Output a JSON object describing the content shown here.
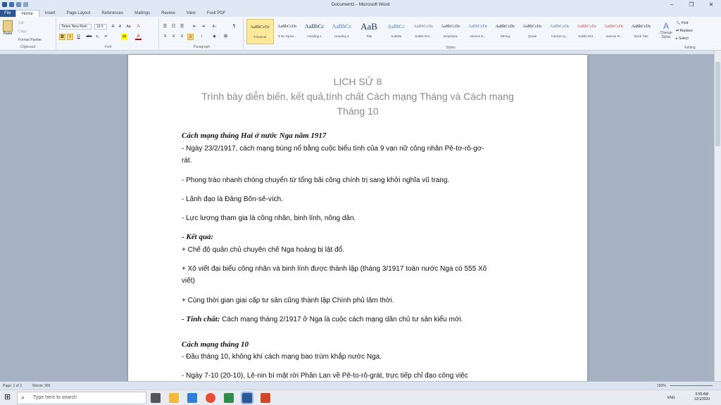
{
  "window": {
    "title": "Document1 - Microsoft Word",
    "minimize": "–",
    "restore": "❐",
    "close": "✕"
  },
  "tabs": [
    "File",
    "Home",
    "Insert",
    "Page Layout",
    "References",
    "Mailings",
    "Review",
    "View",
    "Foxit PDF"
  ],
  "clipboard": {
    "paste": "Paste",
    "cut": "Cut",
    "copy": "Copy",
    "format_painter": "Format Painter",
    "label": "Clipboard"
  },
  "font": {
    "name": "Times New Rom",
    "size": "10.5",
    "label": "Font",
    "bold": "B",
    "italic": "I",
    "underline": "U",
    "strike": "abc",
    "sub": "x₂",
    "sup": "x²",
    "grow": "A",
    "shrink": "A",
    "case": "Aa",
    "clear": "A",
    "highlight": "ab",
    "color": "A"
  },
  "paragraph": {
    "label": "Paragraph",
    "pilcrow": "¶",
    "sort": "A↓"
  },
  "styles": {
    "label": "Styles",
    "items": [
      {
        "preview": "AaBbCcDc",
        "name": "¶ Normal",
        "size": "6",
        "color": "#333"
      },
      {
        "preview": "AaBbCcDc",
        "name": "¶ No Spaci...",
        "size": "6",
        "color": "#333"
      },
      {
        "preview": "AaBbCc",
        "name": "Heading 1",
        "size": "8",
        "color": "#17365d"
      },
      {
        "preview": "AaBbCc",
        "name": "Heading 2",
        "size": "8",
        "color": "#4f81bd"
      },
      {
        "preview": "AaB",
        "name": "Title",
        "size": "13",
        "color": "#17365d"
      },
      {
        "preview": "AaBbCc",
        "name": "Subtitle",
        "size": "7",
        "color": "#4f81bd"
      },
      {
        "preview": "AaBbCcDc",
        "name": "Subtle Em...",
        "size": "6",
        "color": "#777"
      },
      {
        "preview": "AaBbCcDc",
        "name": "Emphasis",
        "size": "6",
        "color": "#333"
      },
      {
        "preview": "AaBbCcDc",
        "name": "Intense E...",
        "size": "6",
        "color": "#4f81bd"
      },
      {
        "preview": "AaBbCcDc",
        "name": "Strong",
        "size": "6",
        "color": "#222"
      },
      {
        "preview": "AaBbCcDc",
        "name": "Quote",
        "size": "6",
        "color": "#333"
      },
      {
        "preview": "AaBbCcDc",
        "name": "Intense Q...",
        "size": "6",
        "color": "#4f81bd"
      },
      {
        "preview": "AaBbCcDc",
        "name": "Subtle Ref...",
        "size": "6",
        "color": "#c0504d"
      },
      {
        "preview": "AaBbCcDc",
        "name": "Intense R...",
        "size": "6",
        "color": "#c0504d"
      },
      {
        "preview": "AaBbCcDc",
        "name": "Book Title",
        "size": "6",
        "color": "#222"
      }
    ],
    "change": "Change Styles"
  },
  "editing": {
    "find": "Find",
    "replace": "Replace",
    "select": "Select",
    "label": "Editing"
  },
  "doc": {
    "title1": "LỊCH SỬ 8",
    "title2": "Trình bày diễn biến, kết quả,tính chất Cách mạng Tháng và Cách mạng",
    "title3": "Tháng 10",
    "h1": "Cách mạng tháng Hai ở nước Nga năm 1917",
    "p1a": "- Ngày 23/2/1917, cách mạng bùng nổ bằng cuộc biểu tình của 9 vạn nữ công nhân Pê-tơ-rô-gơ-",
    "p1b": "rát.",
    "p2": "- Phong trào nhanh chóng chuyển từ tổng bãi công chính trị sang khởi nghĩa vũ trang.",
    "p3": "- Lãnh đạo là Đảng Bôn-sê-vích.",
    "p4": "- Lực lượng tham gia là công nhân, binh lính, nông dân.",
    "kq": "- Kết quả:",
    "p5": "+ Chế độ quân chủ chuyên chế Nga hoàng bị lật đổ.",
    "p6a": "+ Xô viết đại biểu công nhân và binh lính được thành lập (tháng 3/1917 toàn nước Nga có 555 Xô",
    "p6b": "viết)",
    "p7": "+ Cùng thời gian giai cấp tư sản cũng thành lập Chính phủ lâm thời.",
    "tc_label": "- Tính chất:",
    "tc_text": " Cách mạng tháng 2/1917 ở Nga là cuộc cách mạng dân chủ tư sản kiểu mới.",
    "h2": "Cách mạng tháng 10",
    "p8": "- Đầu tháng 10, không khí cách mạng bao trùm khắp nước Nga.",
    "p9": "- Ngày 7-10 (20-10), Lê-nin bí mật rời Phần Lan về Pê-to-rô-grát, trực tiếp chỉ đạo công việc"
  },
  "status": {
    "page": "Page: 1 of 2",
    "words": "Words: 365",
    "zoom": "150%"
  },
  "taskbar": {
    "search": "Type here to search",
    "time": "5:55 AM",
    "date": "12/1/2020",
    "lang": "ENG"
  }
}
